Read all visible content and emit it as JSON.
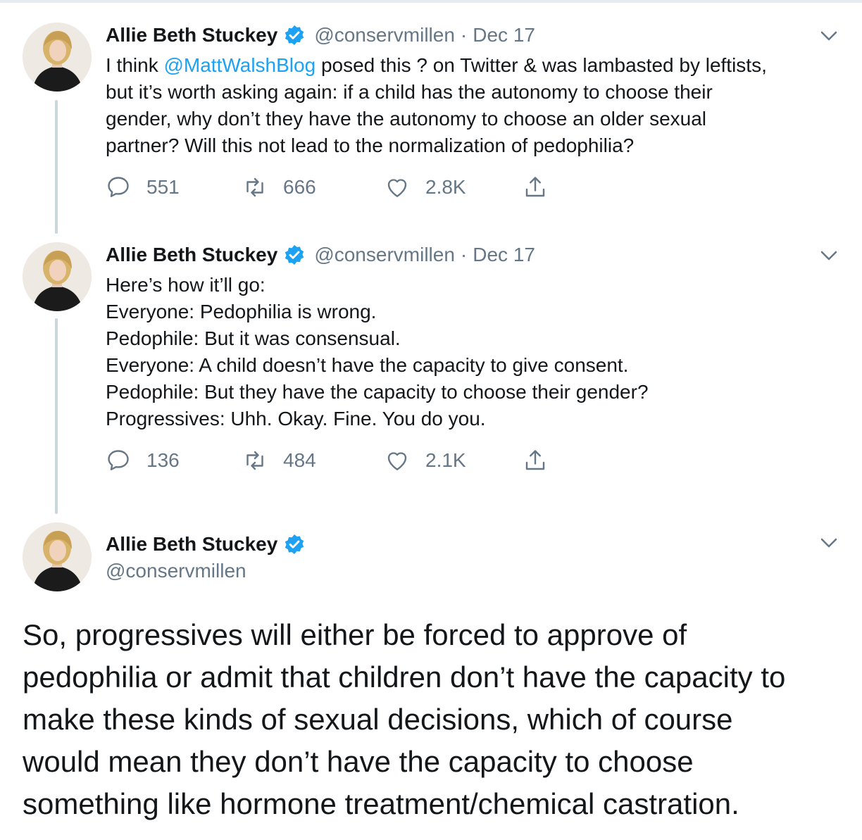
{
  "tweets": [
    {
      "author": "Allie Beth Stuckey",
      "handle": "@conservmillen",
      "separator": "·",
      "date": "Dec 17",
      "text_lines": [
        {
          "pre": "I think ",
          "mention": "@MattWalshBlog",
          "post": " posed this ? on Twitter & was lambasted by leftists,"
        },
        "but it’s worth asking again: if a child has the autonomy to choose their",
        "gender, why don’t they have the autonomy to choose an older sexual",
        "partner? Will this not lead to the normalization of pedophilia?"
      ],
      "replies": "551",
      "retweets": "666",
      "likes": "2.8K"
    },
    {
      "author": "Allie Beth Stuckey",
      "handle": "@conservmillen",
      "separator": "·",
      "date": "Dec 17",
      "text_lines": [
        "Here’s how it’ll go:",
        "Everyone: Pedophilia is wrong.",
        "Pedophile: But it was consensual.",
        "Everyone: A child doesn’t have the capacity to give consent.",
        "Pedophile: But they have the capacity to choose their gender?",
        "Progressives: Uhh. Okay. Fine. You do you."
      ],
      "replies": "136",
      "retweets": "484",
      "likes": "2.1K"
    },
    {
      "author": "Allie Beth Stuckey",
      "handle": "@conservmillen",
      "text_lines": [
        "So, progressives will either be forced to approve of",
        "pedophilia or admit that children don’t have the capacity to",
        "make these kinds of sexual decisions, which of course",
        "would mean they don’t have the capacity to choose",
        "something like hormone treatment/chemical castration."
      ]
    }
  ],
  "colors": {
    "accent": "#1da1f2",
    "muted": "#657786",
    "text": "#14171a",
    "thread_line": "#ccd6dd"
  },
  "icons": [
    "reply-icon",
    "retweet-icon",
    "like-icon",
    "share-icon",
    "verified-badge-icon",
    "chevron-down-icon"
  ]
}
